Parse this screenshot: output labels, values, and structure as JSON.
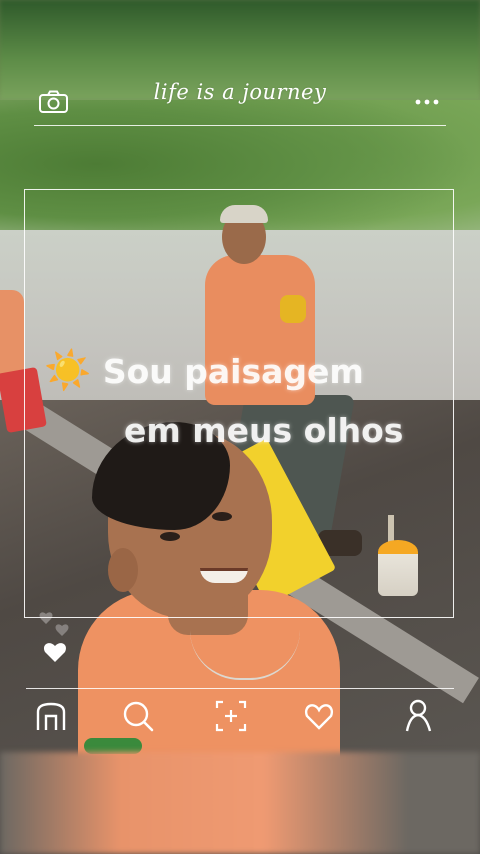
{
  "header": {
    "title": "life is a journey",
    "left_icon": "camera-icon",
    "right_icon": "more-horizontal-icon"
  },
  "post": {
    "caption_emoji": "☀️",
    "caption_line1": "Sou paisagem",
    "caption_line2": "em meus olhos"
  },
  "side_icons": [
    "heart-outline-icon",
    "heart-filled-icon"
  ],
  "bottom_nav": {
    "items": [
      "home-icon",
      "search-icon",
      "add-icon",
      "heart-icon",
      "profile-icon"
    ]
  },
  "colors": {
    "overlay_white": "#ffffff",
    "sun": "#f7b500",
    "shirt_orange": "#ee9262",
    "board_yellow": "#f2d12c"
  }
}
